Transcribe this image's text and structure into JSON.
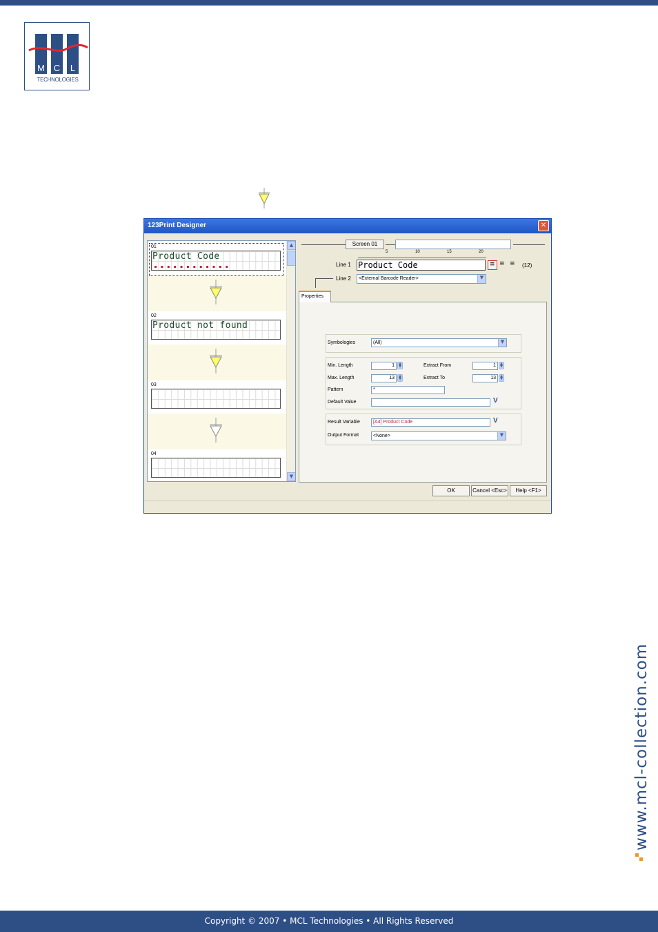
{
  "logo": {
    "letters": [
      "M",
      "C",
      "L"
    ],
    "subtitle": "TECHNOLOGIES"
  },
  "window": {
    "title": "123Print Designer",
    "close_icon": "close-icon"
  },
  "screens": [
    {
      "number": "01",
      "text": "Product Code"
    },
    {
      "number": "02",
      "text": "Product not found"
    },
    {
      "number": "03",
      "text": ""
    },
    {
      "number": "04",
      "text": ""
    }
  ],
  "editor": {
    "screen_label": "Screen 01",
    "ruler_ticks": [
      "5",
      "10",
      "15",
      "20"
    ],
    "line1_label": "Line 1",
    "line1_value": "Product Code",
    "line1_count": "(12)",
    "line2_label": "Line 2",
    "line2_value": "<External Barcode Reader>"
  },
  "properties": {
    "tab_label": "Properties",
    "symbologies_label": "Symbologies",
    "symbologies_value": "(All)",
    "min_length_label": "Min. Length",
    "min_length_value": "1",
    "max_length_label": "Max. Length",
    "max_length_value": "13",
    "extract_from_label": "Extract From",
    "extract_from_value": "1",
    "extract_to_label": "Extract To",
    "extract_to_value": "13",
    "pattern_label": "Pattern",
    "pattern_value": "*",
    "default_value_label": "Default Value",
    "default_value_value": "",
    "result_variable_label": "Result Variable",
    "result_variable_value": "[A4] Product Code",
    "output_format_label": "Output Format",
    "output_format_value": "<None>"
  },
  "buttons": {
    "ok": "OK",
    "cancel": "Cancel <Esc>",
    "help": "Help <F1>"
  },
  "colors": {
    "brand": "#2e4f86",
    "accent_arrow": "#ffff66",
    "result_variable_text": "#c0203a"
  },
  "website": "www.mcl-collection.com",
  "footer": "Copyright © 2007 • MCL Technologies • All Rights Reserved"
}
